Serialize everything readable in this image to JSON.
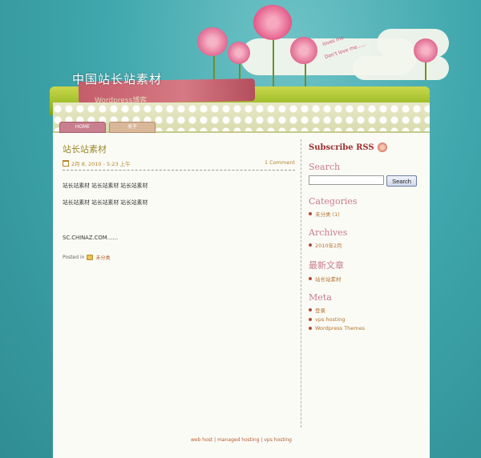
{
  "header": {
    "blog_title": "中国站长站素材",
    "tagline": "Wordpress博客",
    "sky_note_1": "loves me",
    "sky_note_2": "Don't love me......"
  },
  "nav": {
    "tabs": [
      {
        "label": "HOME"
      },
      {
        "label": "关于"
      }
    ]
  },
  "post": {
    "title": "站长站素材",
    "date": "2月 8, 2010 - 5:23 上午",
    "comments": "1 Comment",
    "paragraph1": "站长站素材  站长站素材  站长站素材",
    "paragraph2": "站长站素材   站长站素材   站长站素材",
    "paragraph3": "SC.CHINAZ.COM……",
    "posted_in_label": "Posted in",
    "category": "未分类"
  },
  "sidebar": {
    "rss_label": "Subscribe RSS",
    "search_heading": "Search",
    "search_button": "Search",
    "search_value": "",
    "categories_heading": "Categories",
    "categories": [
      {
        "label": "未分类 (1)"
      }
    ],
    "archives_heading": "Archives",
    "archives": [
      {
        "label": "2010年2月"
      }
    ],
    "recent_heading": "最新文章",
    "recent": [
      {
        "label": "站长站素材"
      }
    ],
    "meta_heading": "Meta",
    "meta": [
      {
        "label": "登录"
      },
      {
        "label": "vps hosting"
      },
      {
        "label": "Wordpress Themes"
      }
    ]
  },
  "footer": {
    "text": "web host | managed hosting | vps hosting"
  }
}
